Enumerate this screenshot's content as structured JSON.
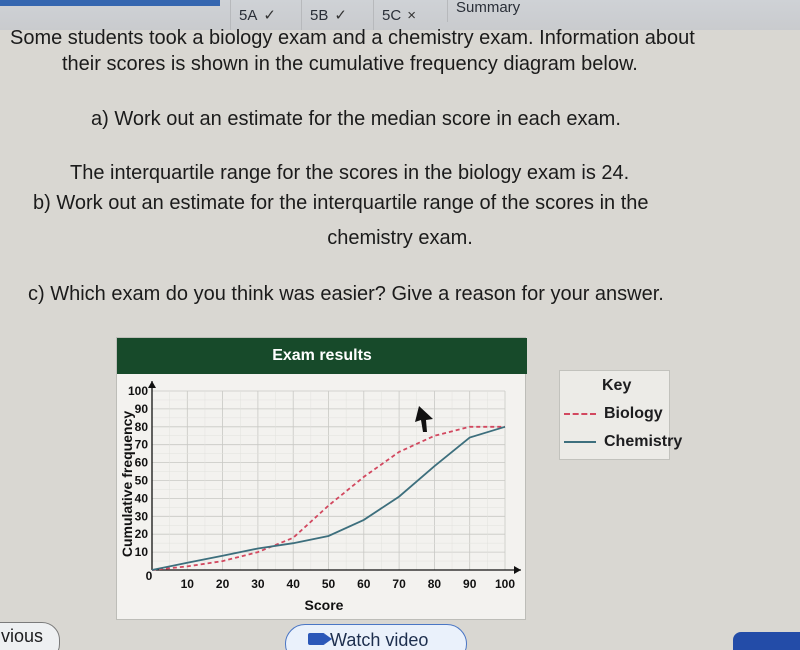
{
  "tabs": [
    {
      "label": "5A",
      "status": "correct",
      "status_glyph": "✓"
    },
    {
      "label": "5B",
      "status": "correct",
      "status_glyph": "✓"
    },
    {
      "label": "5C",
      "status": "incorrect",
      "status_glyph": "×"
    },
    {
      "label": "Summary"
    }
  ],
  "question": {
    "intro_line1": "Some students took a biology exam and a chemistry exam. Information about",
    "intro_line2": "their scores is shown in the cumulative frequency diagram below.",
    "part_a": "a) Work out an estimate for the median score in each exam.",
    "iqr_statement": "The interquartile range for the scores in the biology exam is 24.",
    "part_b_line1": "b) Work out an estimate for the interquartile range of the scores in the",
    "part_b_line2": "chemistry exam.",
    "part_c": "c) Which exam do you think was easier? Give a reason for your answer."
  },
  "key": {
    "title": "Key",
    "biology": "Biology",
    "chemistry": "Chemistry"
  },
  "chart_data": {
    "type": "line",
    "title": "Exam results",
    "xlabel": "Score",
    "ylabel": "Cumulative frequency",
    "xlim": [
      0,
      100
    ],
    "ylim": [
      0,
      100
    ],
    "x_ticks": [
      10,
      20,
      30,
      40,
      50,
      60,
      70,
      80,
      90,
      100
    ],
    "y_ticks": [
      10,
      20,
      30,
      40,
      50,
      60,
      70,
      80,
      90,
      100
    ],
    "origin_label": "0",
    "grid": true,
    "legend": "right",
    "series": [
      {
        "name": "Biology",
        "style": "dashed",
        "color": "#d2485f",
        "x": [
          0,
          10,
          20,
          30,
          40,
          50,
          60,
          70,
          80,
          90,
          100
        ],
        "y": [
          0,
          2,
          5,
          10,
          18,
          36,
          52,
          66,
          75,
          80,
          80
        ]
      },
      {
        "name": "Chemistry",
        "style": "solid",
        "color": "#3d6f7d",
        "x": [
          0,
          10,
          20,
          30,
          40,
          50,
          60,
          70,
          80,
          90,
          100
        ],
        "y": [
          0,
          4,
          8,
          12,
          15,
          19,
          28,
          41,
          58,
          74,
          80
        ]
      }
    ]
  },
  "buttons": {
    "previous": "vious",
    "watch_video": "Watch video"
  },
  "colors": {
    "chart_header": "#174a2a",
    "watch_button_border": "#4a76c5",
    "next_button": "#234ca8"
  }
}
